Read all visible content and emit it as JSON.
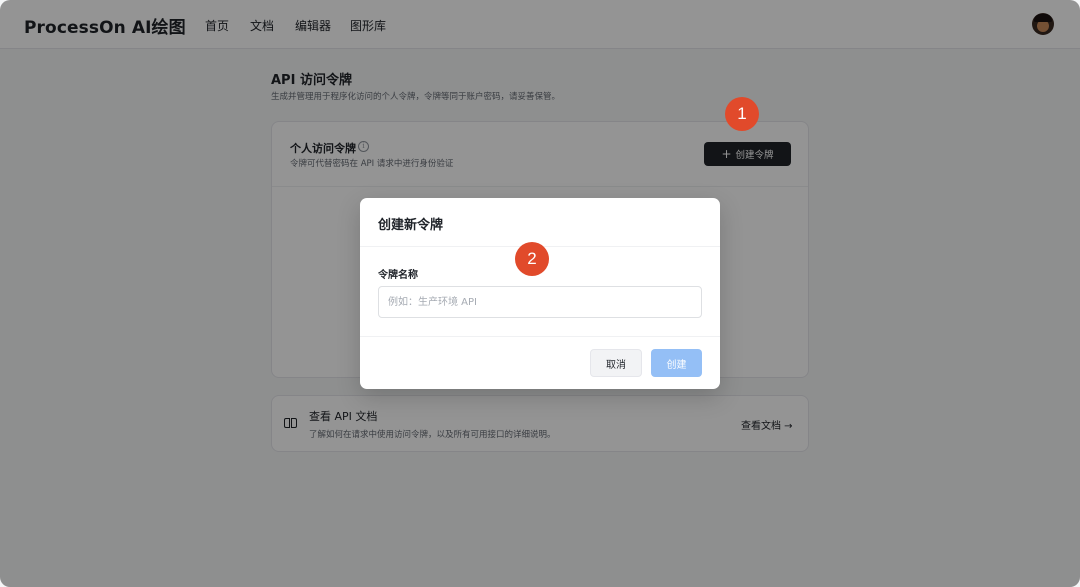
{
  "nav": {
    "brand": "ProcessOn AI绘图",
    "links": [
      "首页",
      "文档",
      "编辑器",
      "图形库"
    ]
  },
  "page": {
    "title": "API 访问令牌",
    "subtitle": "生成并管理用于程序化访问的个人令牌，令牌等同于账户密码，请妥善保管。"
  },
  "tokens_card": {
    "title": "个人访问令牌",
    "info_icon": "ⓘ",
    "subtitle": "令牌可代替密码在 API 请求中进行身份验证",
    "create_button": "创建令牌",
    "create_icon": "+"
  },
  "docs_card": {
    "icon": "book-icon",
    "title": "查看 API 文档",
    "subtitle": "了解如何在请求中使用访问令牌，以及所有可用接口的详细说明。",
    "link": "查看文档 →"
  },
  "modal": {
    "title": "创建新令牌",
    "field_label": "令牌名称",
    "field_value": "",
    "field_placeholder": "例如：生产环境 API",
    "cancel_button": "取消",
    "create_button": "创建"
  },
  "badges": [
    "1",
    "2"
  ],
  "colors": {
    "primary_dark": "#1f2329",
    "disabled_primary": "#94bff6",
    "badge": "#e14a2b"
  }
}
